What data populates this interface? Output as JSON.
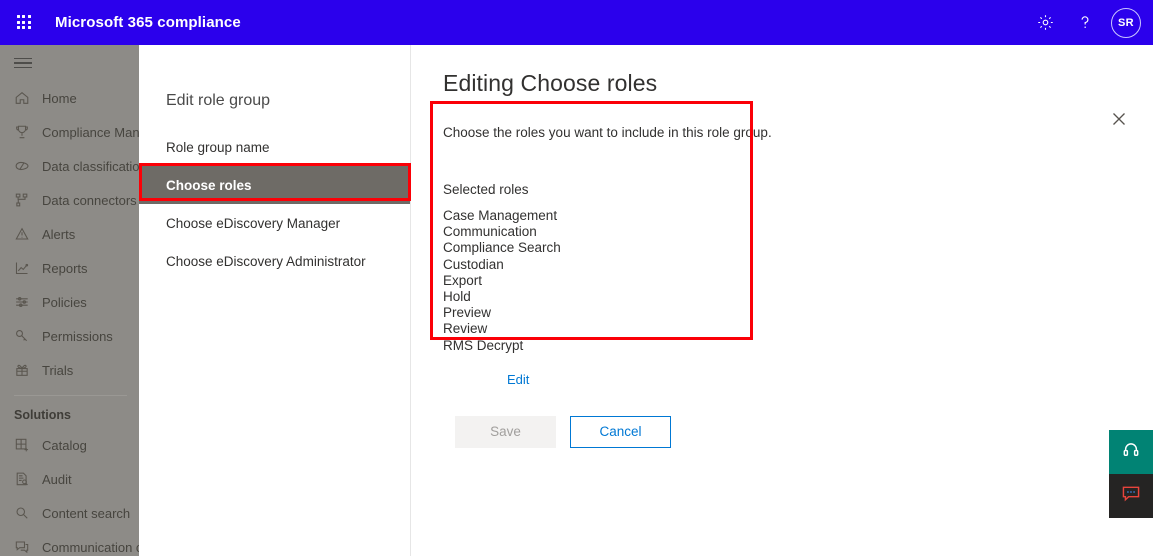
{
  "suite_bar": {
    "waffle_label": "app-launcher",
    "title": "Microsoft 365 compliance",
    "settings_icon": "gear-icon",
    "help_icon": "question-mark-icon",
    "avatar_initials": "SR"
  },
  "left_nav": {
    "hamburger_label": "navigation-menu-toggle",
    "items": [
      {
        "label": "Home",
        "icon": "home-icon"
      },
      {
        "label": "Compliance Manager",
        "icon": "trophy-icon"
      },
      {
        "label": "Data classification",
        "icon": "tag-icon"
      },
      {
        "label": "Data connectors",
        "icon": "connectors-icon"
      },
      {
        "label": "Alerts",
        "icon": "warning-triangle-icon"
      },
      {
        "label": "Reports",
        "icon": "line-chart-icon"
      },
      {
        "label": "Policies",
        "icon": "sliders-icon"
      },
      {
        "label": "Permissions",
        "icon": "key-icon"
      },
      {
        "label": "Trials",
        "icon": "gift-icon"
      }
    ],
    "group_title": "Solutions",
    "solutions": [
      {
        "label": "Catalog",
        "icon": "grid-plus-icon"
      },
      {
        "label": "Audit",
        "icon": "document-search-icon"
      },
      {
        "label": "Content search",
        "icon": "magnifier-icon"
      },
      {
        "label": "Communication compliance",
        "icon": "chat-bubbles-icon"
      }
    ]
  },
  "wizard": {
    "title": "Edit role group",
    "steps": [
      {
        "label": "Role group name",
        "active": false
      },
      {
        "label": "Choose roles",
        "active": true
      },
      {
        "label": "Choose eDiscovery Manager",
        "active": false
      },
      {
        "label": "Choose eDiscovery Administrator",
        "active": false
      }
    ]
  },
  "panel": {
    "heading": "Editing Choose roles",
    "close_icon": "close-icon",
    "helper_text": "Choose the roles you want to include in this role group.",
    "selected_roles_label": "Selected roles",
    "selected_roles": [
      "Case Management",
      "Communication",
      "Compliance Search",
      "Custodian",
      "Export",
      "Hold",
      "Preview",
      "Review",
      "RMS Decrypt"
    ],
    "edit_link": "Edit",
    "save_label": "Save",
    "cancel_label": "Cancel"
  },
  "floating": {
    "support_icon": "headset-icon",
    "feedback_icon": "feedback-chat-icon"
  },
  "colors": {
    "suite_bar": "#2b00ec",
    "accent_blue": "#0078d4",
    "annotation_red": "#fb0007",
    "active_step": "#6e6b66",
    "support_teal": "#018374",
    "feedback_dark": "#252423"
  }
}
